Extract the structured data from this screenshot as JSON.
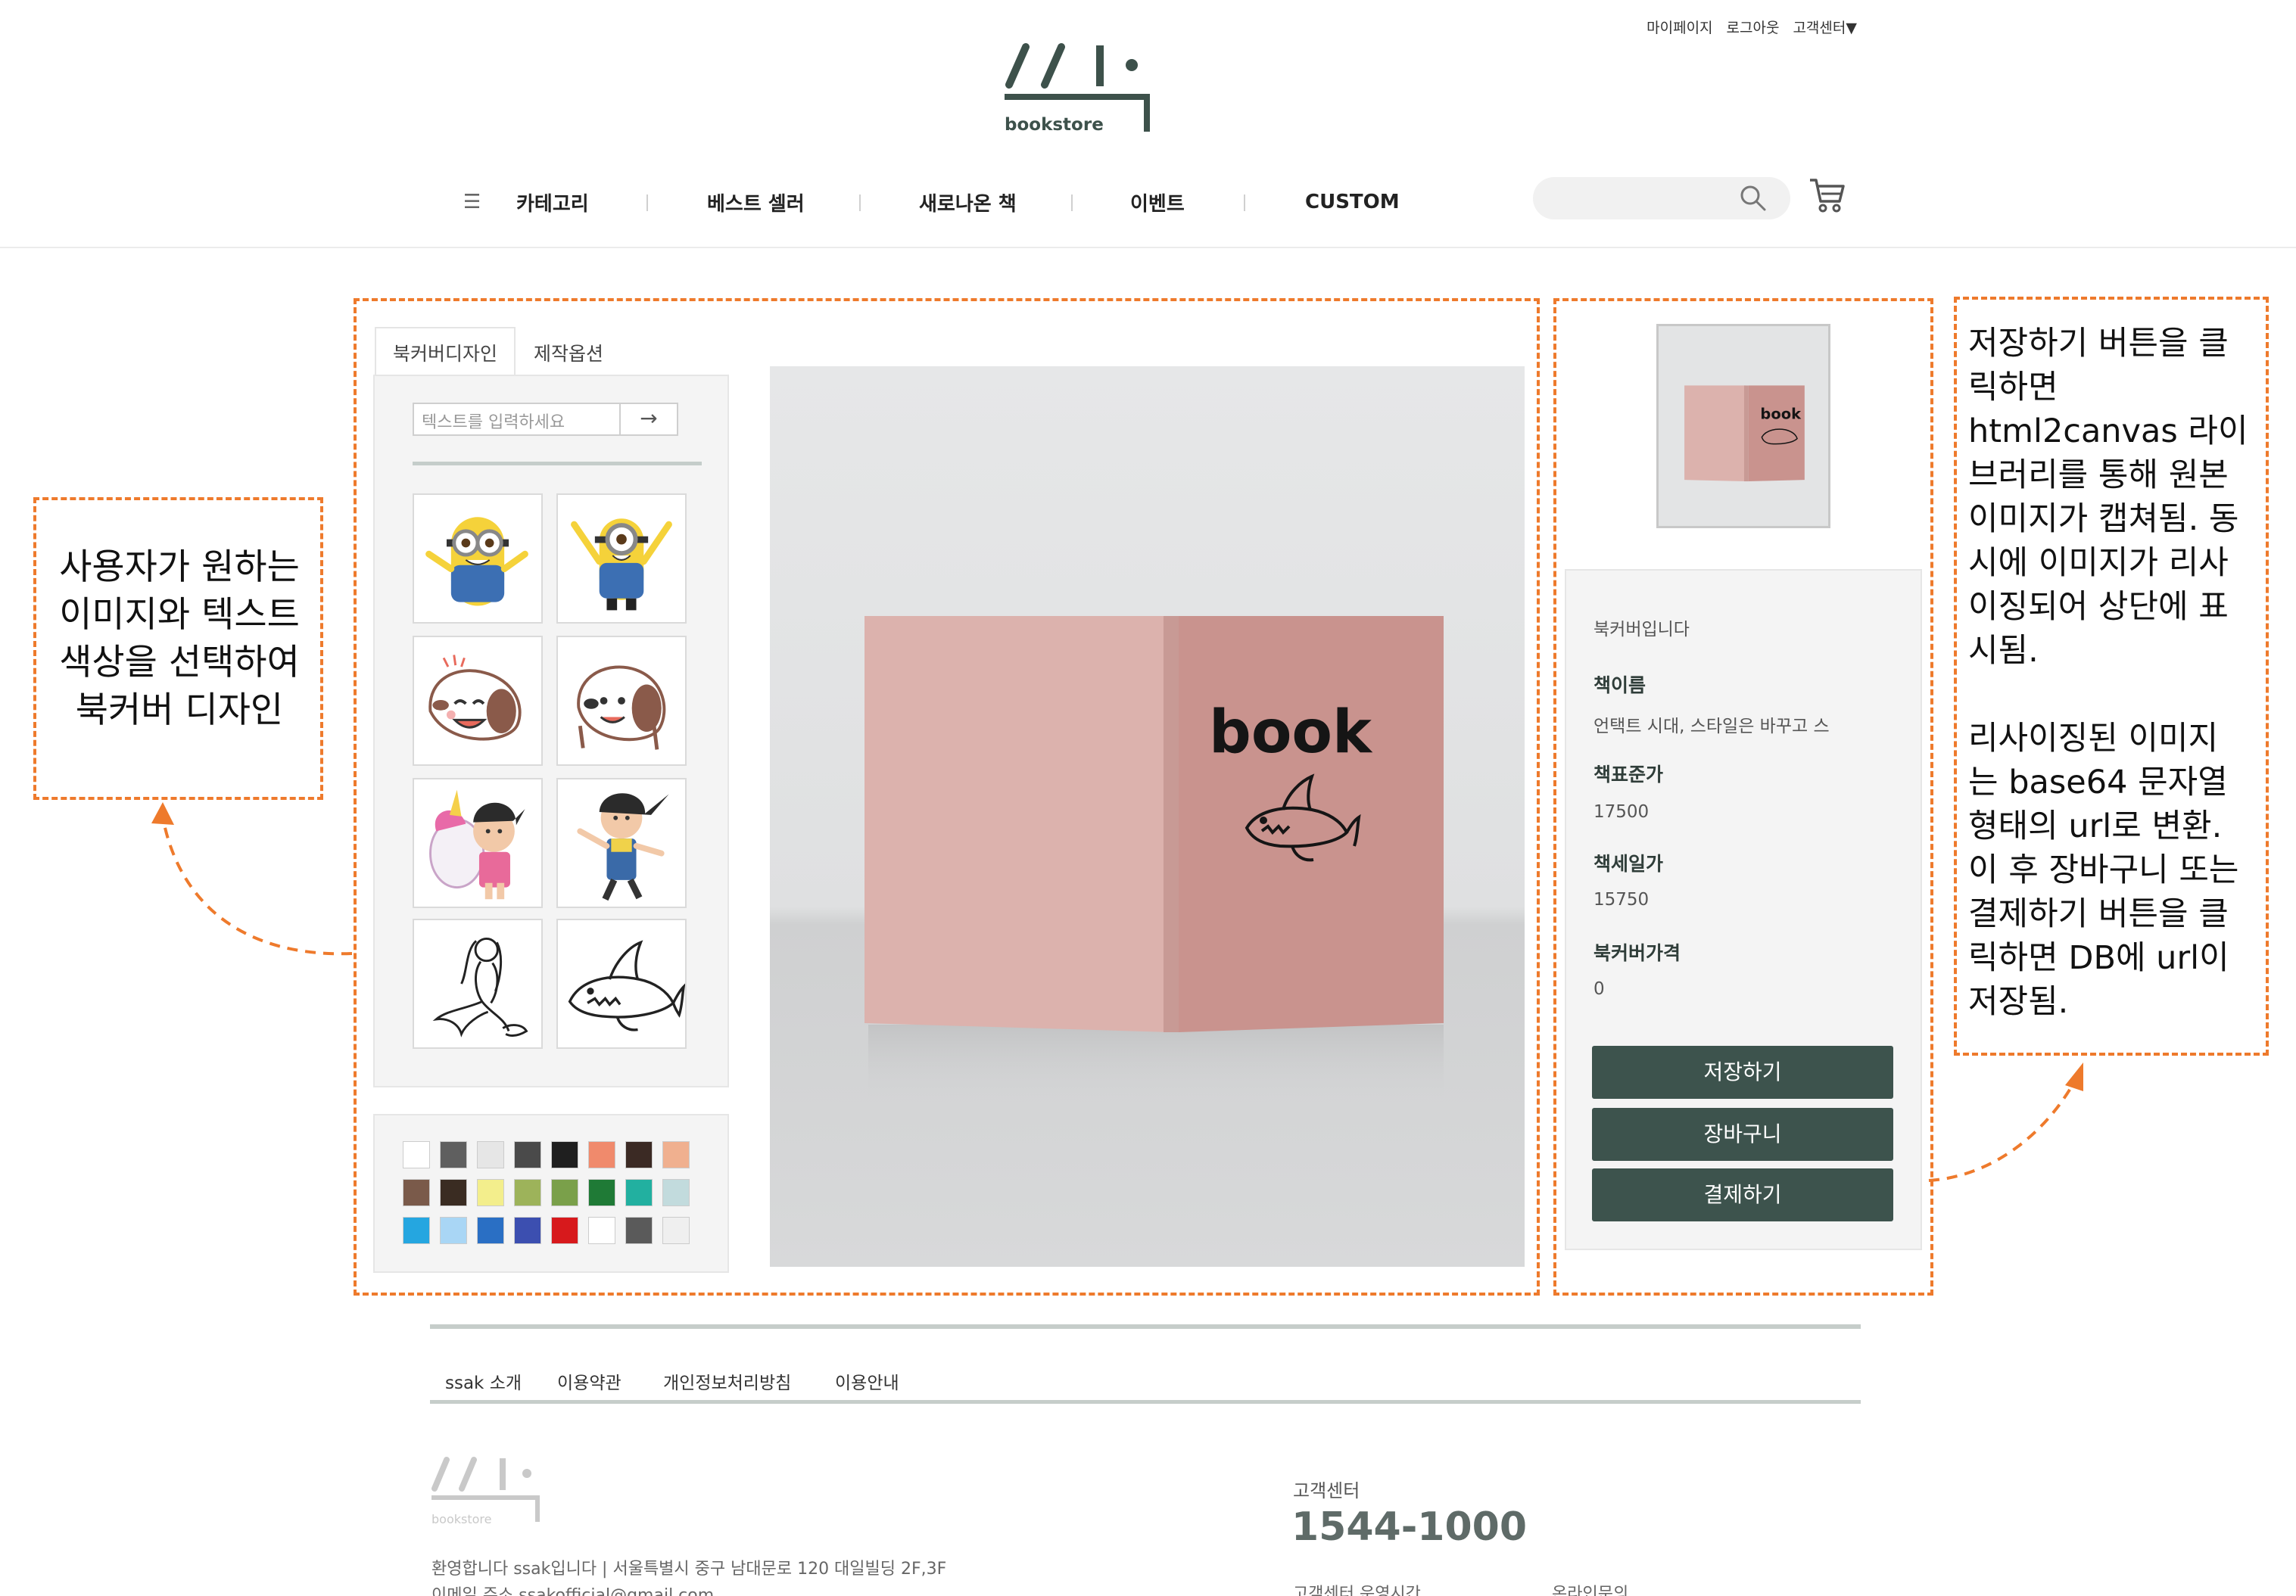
{
  "header": {
    "top_links": [
      "마이페이지",
      "로그아웃",
      "고객센터"
    ],
    "customer_center_caret": "▼",
    "logo_text": "bookstore",
    "nav": {
      "menu_label": "카테고리",
      "items": [
        "베스트 셀러",
        "새로나온 책",
        "이벤트",
        "CUSTOM"
      ]
    },
    "search": {
      "placeholder": ""
    }
  },
  "annotations": {
    "left": [
      "사용자가 원하는",
      "이미지와 텍스트",
      "색상을 선택하여",
      "북커버 디자인"
    ],
    "right": [
      "저장하기 버튼을 클",
      "릭하면",
      "html2canvas 라이",
      "브러리를 통해 원본",
      "이미지가 캡쳐됨. 동",
      "시에 이미지가 리사",
      "이징되어 상단에 표",
      "시됨.",
      "",
      "리사이징된 이미지",
      "는 base64 문자열",
      "형태의 url로 변환.",
      "이 후 장바구니 또는",
      "결제하기 버튼을 클",
      "릭하면 DB에 url이",
      "저장됨."
    ]
  },
  "designer": {
    "tabs": [
      "북커버디자인",
      "제작옵션"
    ],
    "text_placeholder": "텍스트를 입력하세요",
    "submit_arrow": "→",
    "stickers": [
      "minion-1",
      "minion-2",
      "snoopy-1",
      "snoopy-2",
      "agnes-unicorn",
      "agnes-jump",
      "mermaid-lineart",
      "shark-lineart"
    ],
    "swatches": [
      "#ffffff",
      "#5f5f5f",
      "#e6e6e6",
      "#4a4a4a",
      "#1f1f1f",
      "#f08a6c",
      "#3b2a24",
      "#f0b08f",
      "#7a5a4a",
      "#3a2c22",
      "#f3ee8c",
      "#9db35a",
      "#7aa04a",
      "#1f7a36",
      "#22b0a0",
      "#c2dbdd",
      "#25a6e0",
      "#a9d6f5",
      "#2a6fc4",
      "#3c4fb0",
      "#d7191c",
      "#ffffff",
      "#5a5a5a",
      "#efefef"
    ]
  },
  "preview": {
    "cover_text": "book"
  },
  "info": {
    "title": "북커버입니다",
    "book_name_label": "책이름",
    "book_name": "언택트 시대, 스타일은 바꾸고 스",
    "list_price_label": "책표준가",
    "list_price": "17500",
    "sale_price_label": "책세일가",
    "sale_price": "15750",
    "cover_price_label": "북커버가격",
    "cover_price": "0",
    "buttons": {
      "save": "저장하기",
      "cart": "장바구니",
      "checkout": "결제하기"
    }
  },
  "footer": {
    "links": [
      "ssak 소개",
      "이용약관",
      "개인정보처리방침",
      "이용안내"
    ],
    "logo_text": "bookstore",
    "address": "환영합니다 ssak입니다  |  서울특별시 중구 남대문로 120 대일빌딩 2F,3F",
    "email": "이메일 주소 ssakofficial@gmail.com",
    "cs_label": "고객센터",
    "cs_phone": "1544-1000",
    "cs_hours_label": "고객센터 운영시간",
    "online_label": "온라인문의"
  },
  "colors": {
    "accent": "#ee7a2c",
    "brand": "#3d534d",
    "cover": "#d9a8a4"
  }
}
